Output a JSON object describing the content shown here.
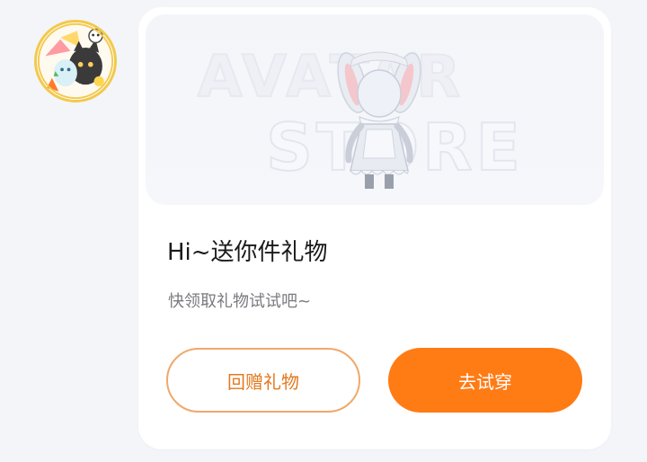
{
  "avatar": {
    "alt": "user avatar sticker"
  },
  "gift_card": {
    "banner_watermark_line1": "AVATAR",
    "banner_watermark_line2": "STORE",
    "figure": "outfit-figure",
    "title": "Hi~送你件礼物",
    "subtitle": "快领取礼物试试吧~",
    "return_gift_label": "回赠礼物",
    "try_on_label": "去试穿"
  },
  "colors": {
    "accent": "#ff7b14",
    "accent_text": "#e2791f",
    "page_bg": "#f4f5f9",
    "card_bg": "#ffffff"
  }
}
